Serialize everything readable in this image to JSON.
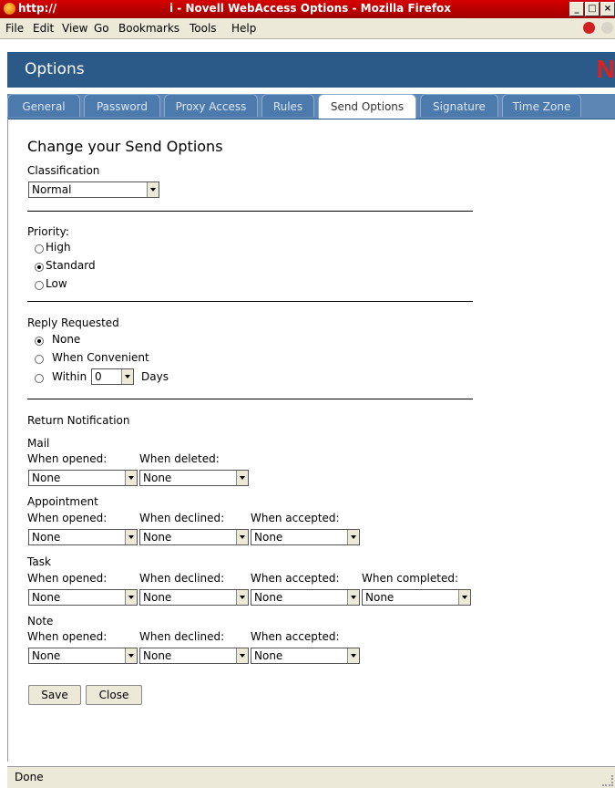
{
  "window": {
    "title_left": "http://",
    "title": "i - Novell WebAccess Options - Mozilla Firefox",
    "buttons": [
      "_",
      "□",
      "×"
    ]
  },
  "menubar": {
    "items": [
      "File",
      "Edit",
      "View",
      "Go",
      "Bookmarks",
      "Tools",
      "Help"
    ]
  },
  "header": {
    "title": "Options",
    "logo": "N"
  },
  "tabs": [
    {
      "label": "General",
      "active": false
    },
    {
      "label": "Password",
      "active": false
    },
    {
      "label": "Proxy Access",
      "active": false
    },
    {
      "label": "Rules",
      "active": false
    },
    {
      "label": "Send Options",
      "active": true
    },
    {
      "label": "Signature",
      "active": false
    },
    {
      "label": "Time Zone",
      "active": false
    }
  ],
  "page": {
    "heading": "Change your Send Options",
    "classification": {
      "label": "Classification",
      "value": "Normal"
    },
    "priority": {
      "label": "Priority:",
      "options": [
        {
          "label": "High",
          "selected": false
        },
        {
          "label": "Standard",
          "selected": true
        },
        {
          "label": "Low",
          "selected": false
        }
      ]
    },
    "reply": {
      "label": "Reply Requested",
      "options": [
        {
          "label": "None",
          "selected": true
        },
        {
          "label": "When Convenient",
          "selected": false
        },
        {
          "label": "Within",
          "selected": false
        }
      ],
      "within_value": "0",
      "days_label": "Days"
    },
    "return_notification": {
      "label": "Return Notification",
      "mail": {
        "label": "Mail",
        "fields": [
          {
            "label": "When opened:",
            "value": "None"
          },
          {
            "label": "When deleted:",
            "value": "None"
          }
        ]
      },
      "appointment": {
        "label": "Appointment",
        "fields": [
          {
            "label": "When opened:",
            "value": "None"
          },
          {
            "label": "When declined:",
            "value": "None"
          },
          {
            "label": "When accepted:",
            "value": "None"
          }
        ]
      },
      "task": {
        "label": "Task",
        "fields": [
          {
            "label": "When opened:",
            "value": "None"
          },
          {
            "label": "When declined:",
            "value": "None"
          },
          {
            "label": "When accepted:",
            "value": "None"
          },
          {
            "label": "When completed:",
            "value": "None"
          }
        ]
      },
      "note": {
        "label": "Note",
        "fields": [
          {
            "label": "When opened:",
            "value": "None"
          },
          {
            "label": "When declined:",
            "value": "None"
          },
          {
            "label": "When accepted:",
            "value": "None"
          }
        ]
      }
    },
    "buttons": {
      "save": "Save",
      "close": "Close"
    }
  },
  "status": {
    "text": "Done"
  }
}
